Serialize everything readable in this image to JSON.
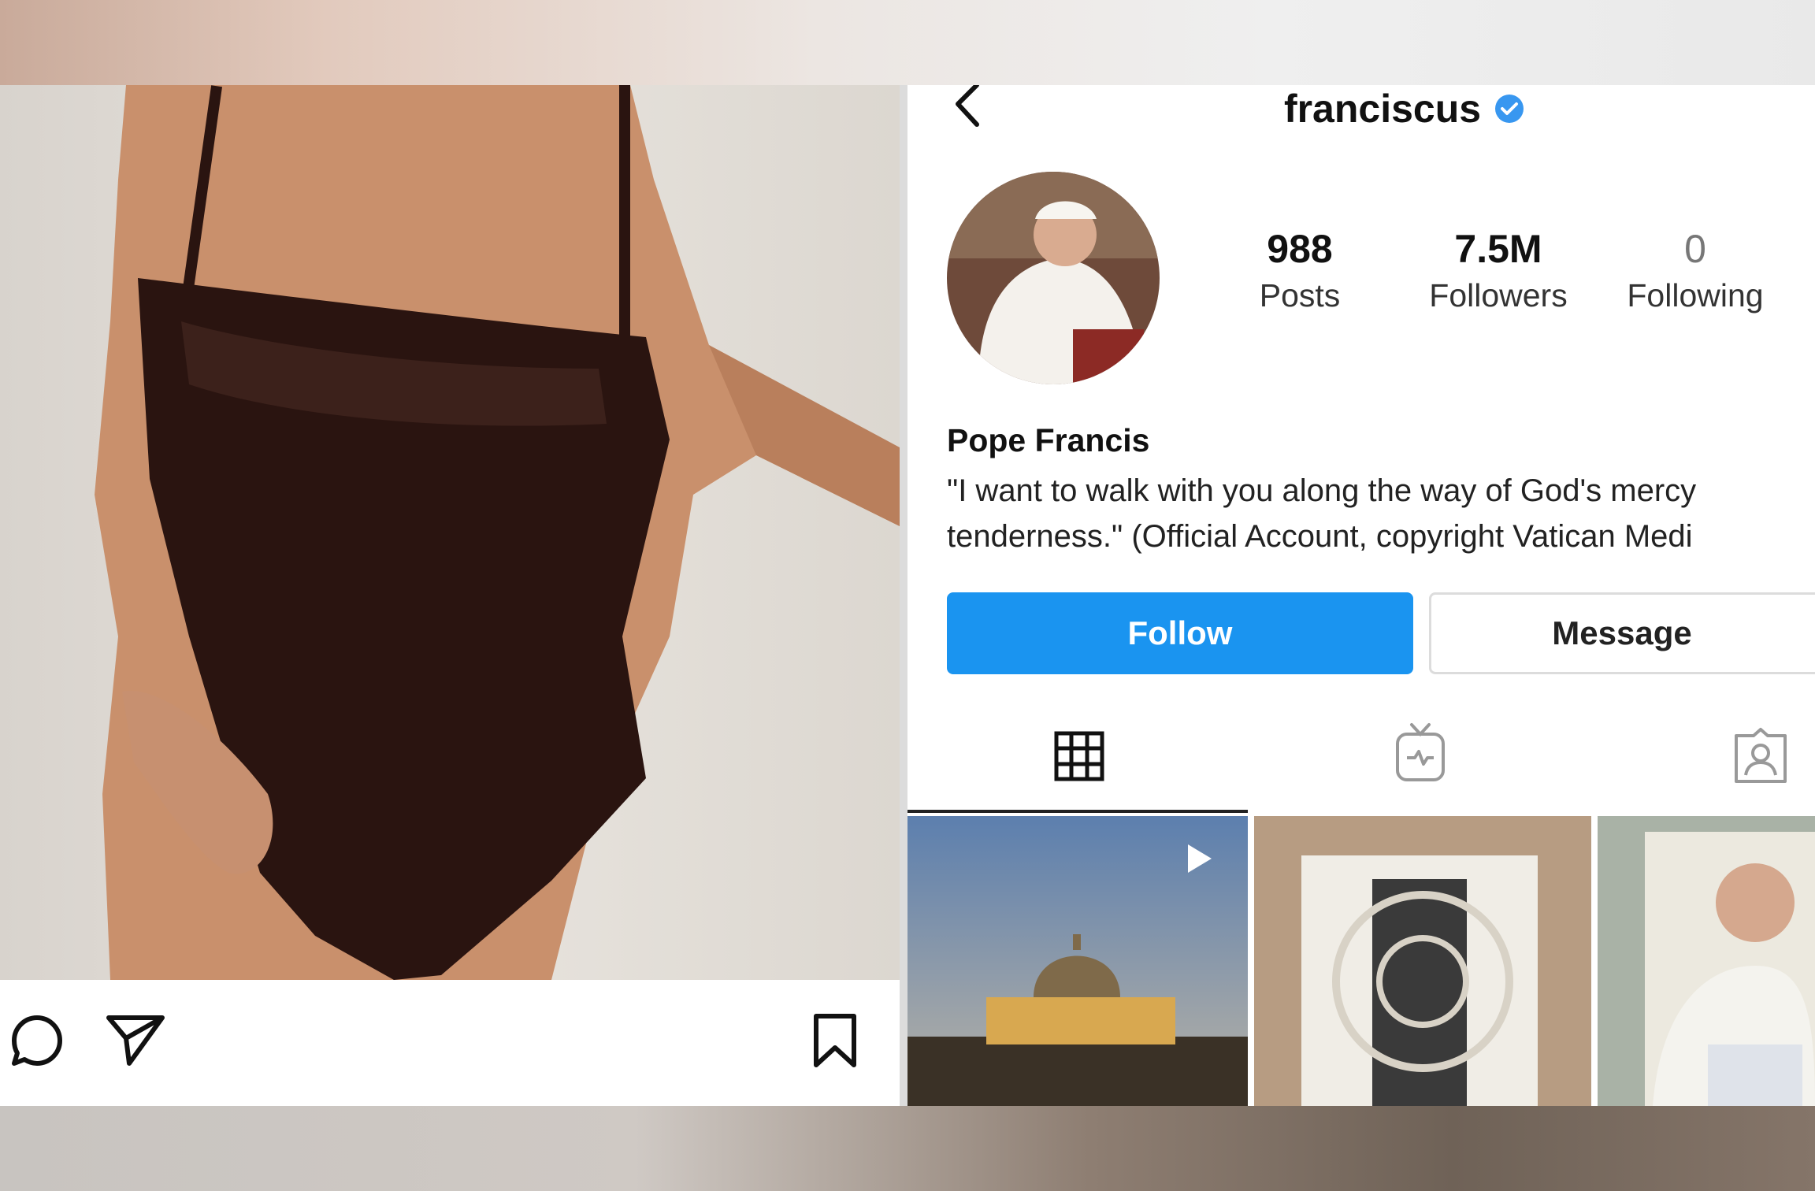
{
  "post": {
    "icons": [
      "comment-icon",
      "send-icon",
      "bookmark-icon"
    ]
  },
  "profile": {
    "username": "franciscus",
    "verified": true,
    "stats": [
      {
        "value": "988",
        "label": "Posts"
      },
      {
        "value": "7.5M",
        "label": "Followers"
      },
      {
        "value": "0",
        "label": "Following"
      }
    ],
    "name": "Pope Francis",
    "bio_line1": "\"I want to walk with you along the way of God's mercy",
    "bio_line2": "tenderness.\" (Official Account, copyright Vatican Medi",
    "follow_label": "Follow",
    "message_label": "Message",
    "tabs": [
      "grid-icon",
      "igtv-icon",
      "tagged-icon"
    ]
  },
  "colors": {
    "follow_blue": "#1a94f0",
    "verified_blue": "#3897f0"
  }
}
